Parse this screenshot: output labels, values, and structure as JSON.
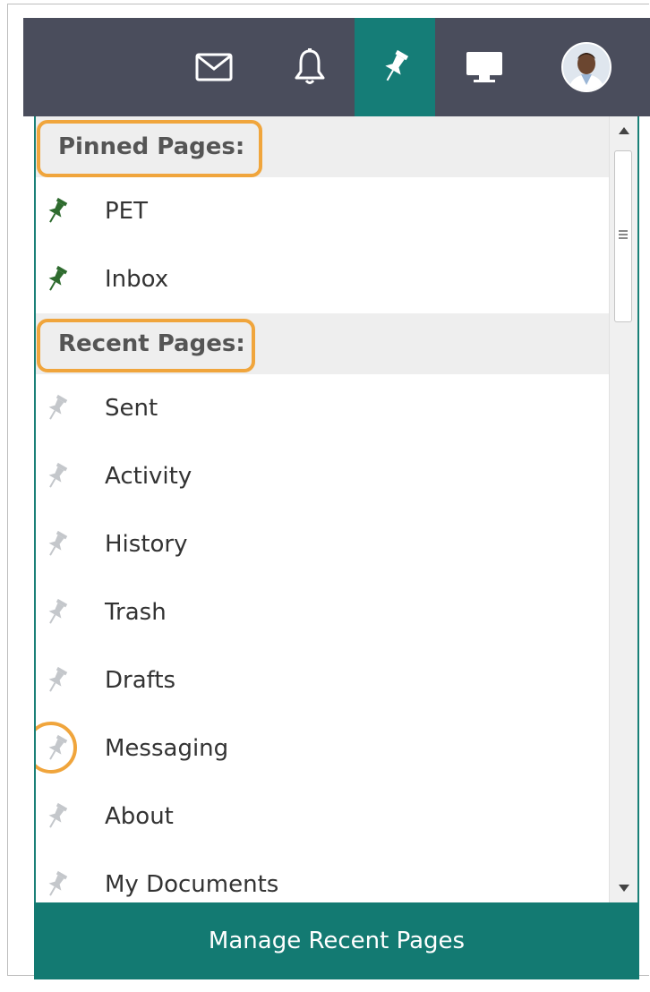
{
  "header": {
    "icons": [
      "mail-icon",
      "bell-icon",
      "pin-icon",
      "desktop-icon",
      "avatar"
    ],
    "active_icon": "pin-icon",
    "active_color": "#157d77",
    "bar_color": "#4a4d5c"
  },
  "pinned": {
    "title": "Pinned Pages:",
    "items": [
      {
        "label": "PET",
        "pinned": true
      },
      {
        "label": "Inbox",
        "pinned": true
      }
    ]
  },
  "recent": {
    "title": "Recent Pages:",
    "items": [
      {
        "label": "Sent",
        "pinned": false
      },
      {
        "label": "Activity",
        "pinned": false
      },
      {
        "label": "History",
        "pinned": false
      },
      {
        "label": "Trash",
        "pinned": false
      },
      {
        "label": "Drafts",
        "pinned": false
      },
      {
        "label": "Messaging",
        "pinned": false
      },
      {
        "label": "About",
        "pinned": false
      },
      {
        "label": "My Documents",
        "pinned": false
      }
    ]
  },
  "footer": {
    "manage_label": "Manage Recent Pages"
  },
  "colors": {
    "pin_active": "#2e6b2e",
    "pin_inactive": "#c4c7cb",
    "highlight": "#f0a53c",
    "accent": "#137a72"
  }
}
